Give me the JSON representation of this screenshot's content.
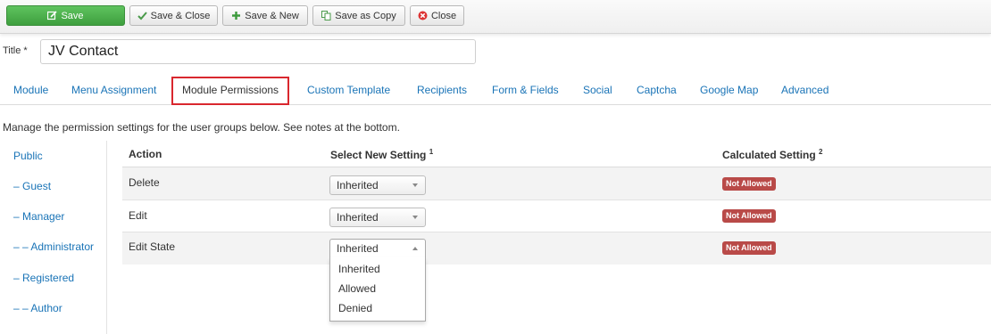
{
  "toolbar": {
    "save": "Save",
    "save_close": "Save & Close",
    "save_new": "Save & New",
    "save_copy": "Save as Copy",
    "close": "Close"
  },
  "title": {
    "label": "Title *",
    "value": "JV Contact"
  },
  "tabs": [
    {
      "label": "Module"
    },
    {
      "label": "Menu Assignment"
    },
    {
      "label": "Module Permissions"
    },
    {
      "label": "Custom Template"
    },
    {
      "label": "Recipients"
    },
    {
      "label": "Form & Fields"
    },
    {
      "label": "Social"
    },
    {
      "label": "Captcha"
    },
    {
      "label": "Google Map"
    },
    {
      "label": "Advanced"
    }
  ],
  "active_tab": "Module Permissions",
  "description": "Manage the permission settings for the user groups below. See notes at the bottom.",
  "groups": [
    {
      "label": "Public"
    },
    {
      "label": "– Guest"
    },
    {
      "label": "– Manager"
    },
    {
      "label": "– – Administrator"
    },
    {
      "label": "– Registered"
    },
    {
      "label": "– – Author"
    }
  ],
  "table": {
    "headers": {
      "action": "Action",
      "new_setting": "Select New Setting",
      "new_setting_note": "1",
      "calculated": "Calculated Setting",
      "calculated_note": "2"
    },
    "rows": [
      {
        "action": "Delete",
        "setting": "Inherited",
        "calculated": "Not Allowed"
      },
      {
        "action": "Edit",
        "setting": "Inherited",
        "calculated": "Not Allowed"
      },
      {
        "action": "Edit State",
        "setting": "Inherited",
        "calculated": "Not Allowed"
      }
    ]
  },
  "dropdown_options": [
    "Inherited",
    "Allowed",
    "Denied"
  ],
  "colors": {
    "save_button": "#46a546",
    "link": "#1a74b7",
    "active_tab_border": "#d9272e",
    "badge": "#b94a48"
  }
}
